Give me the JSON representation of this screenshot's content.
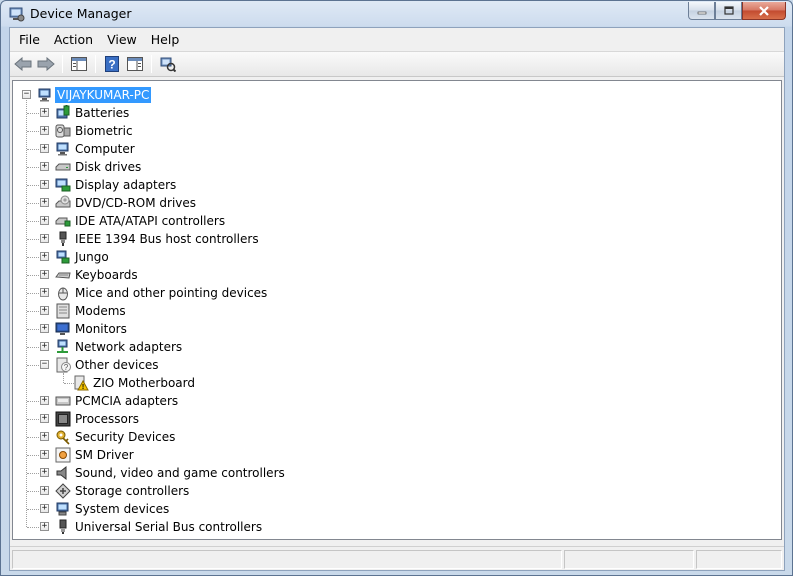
{
  "window": {
    "title": "Device Manager",
    "icon": "device-manager-icon"
  },
  "menu": [
    "File",
    "Action",
    "View",
    "Help"
  ],
  "toolbar": {
    "buttons": [
      {
        "name": "back-button",
        "icon": "arrow-left-icon"
      },
      {
        "name": "forward-button",
        "icon": "arrow-right-icon"
      },
      {
        "name": "show-hide-console-tree-button",
        "icon": "console-tree-icon"
      },
      {
        "name": "help-button",
        "icon": "help-icon"
      },
      {
        "name": "action-pane-button",
        "icon": "action-pane-icon"
      },
      {
        "name": "scan-hardware-button",
        "icon": "scan-hardware-icon"
      }
    ]
  },
  "tree": {
    "root": {
      "label": "VIJAYKUMAR-PC",
      "icon": "computer-icon",
      "expanded": true,
      "selected": true
    },
    "categories": [
      {
        "label": "Batteries",
        "icon": "battery-icon",
        "expanded": false
      },
      {
        "label": "Biometric",
        "icon": "biometric-icon",
        "expanded": false
      },
      {
        "label": "Computer",
        "icon": "computer-icon",
        "expanded": false
      },
      {
        "label": "Disk drives",
        "icon": "disk-drive-icon",
        "expanded": false
      },
      {
        "label": "Display adapters",
        "icon": "display-adapter-icon",
        "expanded": false
      },
      {
        "label": "DVD/CD-ROM drives",
        "icon": "dvd-drive-icon",
        "expanded": false
      },
      {
        "label": "IDE ATA/ATAPI controllers",
        "icon": "ide-controller-icon",
        "expanded": false
      },
      {
        "label": "IEEE 1394 Bus host controllers",
        "icon": "ieee1394-icon",
        "expanded": false
      },
      {
        "label": "Jungo",
        "icon": "jungo-icon",
        "expanded": false
      },
      {
        "label": "Keyboards",
        "icon": "keyboard-icon",
        "expanded": false
      },
      {
        "label": "Mice and other pointing devices",
        "icon": "mouse-icon",
        "expanded": false
      },
      {
        "label": "Modems",
        "icon": "modem-icon",
        "expanded": false
      },
      {
        "label": "Monitors",
        "icon": "monitor-icon",
        "expanded": false
      },
      {
        "label": "Network adapters",
        "icon": "network-adapter-icon",
        "expanded": false
      },
      {
        "label": "Other devices",
        "icon": "unknown-device-icon",
        "expanded": true,
        "children": [
          {
            "label": "ZIO Motherboard",
            "icon": "warning-device-icon"
          }
        ]
      },
      {
        "label": "PCMCIA adapters",
        "icon": "pcmcia-icon",
        "expanded": false
      },
      {
        "label": "Processors",
        "icon": "processor-icon",
        "expanded": false
      },
      {
        "label": "Security Devices",
        "icon": "security-key-icon",
        "expanded": false
      },
      {
        "label": "SM Driver",
        "icon": "sm-driver-icon",
        "expanded": false
      },
      {
        "label": "Sound, video and game controllers",
        "icon": "speaker-icon",
        "expanded": false
      },
      {
        "label": "Storage controllers",
        "icon": "storage-controller-icon",
        "expanded": false
      },
      {
        "label": "System devices",
        "icon": "system-device-icon",
        "expanded": false
      },
      {
        "label": "Universal Serial Bus controllers",
        "icon": "usb-icon",
        "expanded": false
      }
    ]
  },
  "colors": {
    "selection": "#3399ff",
    "close_button": "#c24a2f"
  }
}
